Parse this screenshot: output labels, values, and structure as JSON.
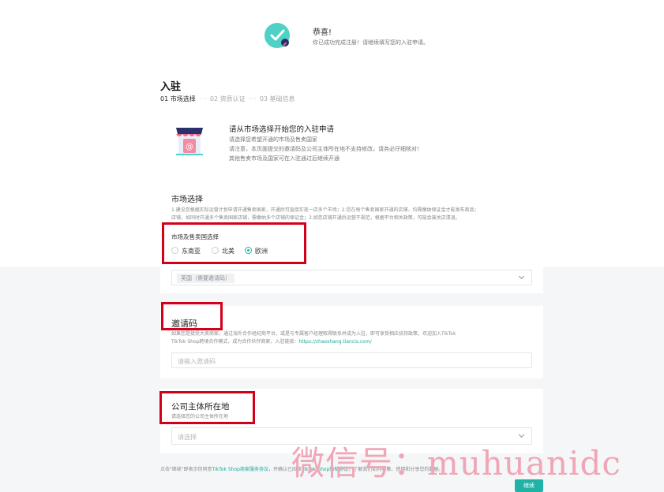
{
  "success": {
    "title": "恭喜!",
    "desc": "你已成功完成注册！请继续填写您的入驻申请。"
  },
  "page": {
    "title": "入驻",
    "steps": [
      {
        "label": "01 市场选择",
        "sep": "····"
      },
      {
        "label": "02 资质认证",
        "sep": "····"
      },
      {
        "label": "03 基础信息",
        "sep": ""
      }
    ]
  },
  "intro": {
    "heading": "请从市场选择开始您的入驻申请",
    "line1": "请选择您希望开通的市场及售卖国家",
    "line2": "请注意，本页面提交的邀请码及公司主体所在地不支持修改，请务必仔细核对!",
    "line3": "其他售卖市场及国家可在入驻通过后继续开通"
  },
  "market": {
    "title": "市场选择",
    "note1": "1.建议您根据实际运营计划申请开通售卖国家，开通后可直接实现一店多个市场；2.您在每个售卖国家开通的店铺，均需缴纳保证金才能发布商品；",
    "note2": "店铺，如同时开通多个售卖国家店铺，需缴纳多个店铺的保证金；3.如您店铺开通后运营不规范，根据平台相关政策，可能会被关店清退。",
    "region_label": "市场及售卖国选择",
    "options": [
      {
        "label": "东南亚",
        "selected": false
      },
      {
        "label": "北美",
        "selected": false
      },
      {
        "label": "欧洲",
        "selected": true
      }
    ],
    "country_tag": "英国（需要邀请码）"
  },
  "invite": {
    "title": "邀请码",
    "desc1": "如果您是接受大卖商家，通过海外合作经纪商平台，或是与专属客户经理取得联系并成为入驻，即可享受相应扶持政策，欢迎加入TikTok",
    "desc2": "TikTok Shop跨境合作模式，成为合作伙伴商家，入驻链接：",
    "link": "https://zhaoshang.tiancis.com/",
    "placeholder": "请输入邀请码"
  },
  "company": {
    "title": "公司主体所在地",
    "desc": "请选择您的公司主体所在地",
    "placeholder": "请选择"
  },
  "footer": {
    "agree_prefix": "点击\"继续\"即表示你同意",
    "agree_link1": "TikTok Shop商家服务协议",
    "agree_mid": "，并确认已阅读",
    "agree_link2": "TikTok Shop隐私协议",
    "agree_suffix": "，了解我们如何收集、使用和分享您的数据。",
    "next_label": "继续"
  },
  "watermark": "微信号：muhuanidc",
  "colors": {
    "accent": "#20b2a5",
    "highlight": "#d4001a"
  }
}
